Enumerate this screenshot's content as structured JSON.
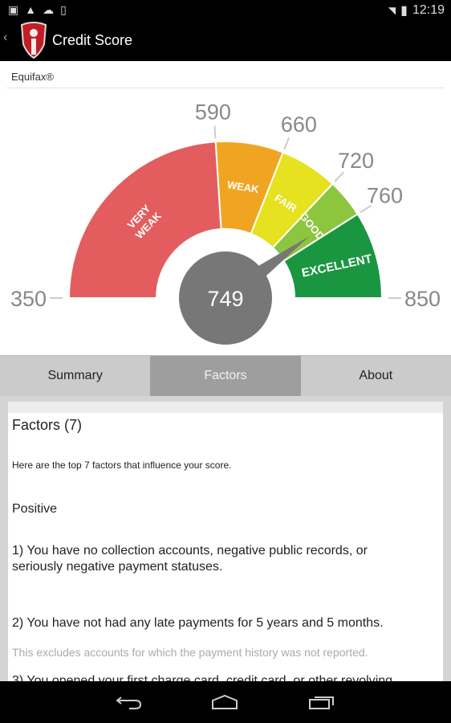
{
  "status_bar": {
    "time": "12:19",
    "icons": [
      "image-icon",
      "warning-icon",
      "cloud-upload-icon",
      "download-icon",
      "wifi-icon",
      "battery-icon"
    ]
  },
  "app_bar": {
    "title": "Credit Score"
  },
  "bureau": "Equifax®",
  "chart_data": {
    "type": "gauge",
    "min": 350,
    "max": 850,
    "value": 749,
    "value_label": "749",
    "segments": [
      {
        "label": "VERY WEAK",
        "from": 350,
        "to": 590,
        "color": "#e35d5f"
      },
      {
        "label": "WEAK",
        "from": 590,
        "to": 660,
        "color": "#f0a522"
      },
      {
        "label": "FAIR",
        "from": 660,
        "to": 720,
        "color": "#e6e21f"
      },
      {
        "label": "GOOD",
        "from": 720,
        "to": 760,
        "color": "#8cc63f"
      },
      {
        "label": "EXCELLENT",
        "from": 760,
        "to": 850,
        "color": "#1a9641"
      }
    ],
    "tick_labels": [
      "350",
      "590",
      "660",
      "720",
      "760",
      "850"
    ]
  },
  "tabs": [
    {
      "label": "Summary"
    },
    {
      "label": "Factors",
      "active": true
    },
    {
      "label": "About"
    }
  ],
  "factors": {
    "heading": "Factors (7)",
    "intro": "Here are the top 7 factors that influence your score.",
    "section": "Positive",
    "items": [
      {
        "text_line1": "1) You have no collection accounts, negative public records, or",
        "text_line2": "seriously negative payment statuses."
      },
      {
        "text_line1": "2) You have not had any late payments for 5 years and 5 months.",
        "note": "This excludes accounts for which the payment history was not reported."
      },
      {
        "text_line1": "3) You opened your first charge card, credit card, or other revolving"
      }
    ]
  }
}
